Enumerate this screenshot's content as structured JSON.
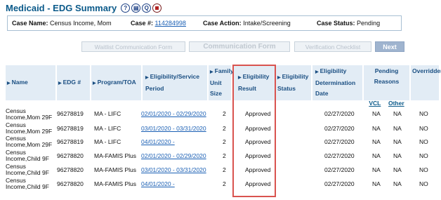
{
  "page": {
    "title": "Medicaid - EDG Summary"
  },
  "title_icons": [
    {
      "name": "help-icon",
      "glyph": "?"
    },
    {
      "name": "notes-icon",
      "glyph": "▤"
    },
    {
      "name": "query-icon",
      "glyph": "Q"
    },
    {
      "name": "stop-icon",
      "glyph": ""
    }
  ],
  "case_info": {
    "name_label": "Case Name:",
    "name_value": "Census Income, Mom",
    "number_label": "Case #:",
    "number_value": "114284998",
    "action_label": "Case Action:",
    "action_value": "Intake/Screening",
    "status_label": "Case Status:",
    "status_value": "Pending"
  },
  "buttons": {
    "waitlist": "Waitlist Communication Form",
    "communication": "Communication Form",
    "verification": "Verification Checklist",
    "next": "Next"
  },
  "table": {
    "headers": {
      "name": "Name",
      "edg": "EDG #",
      "program": "Program/TOA",
      "period": "Eligibility/Service Period",
      "family": "Family Unit Size",
      "result": "Eligibility Result",
      "status": "Eligibility Status",
      "determination": "Eligibility Determination Date",
      "pending": "Pending Reasons",
      "vcl": "VCL",
      "other": "Other",
      "overridden": "Overridden"
    },
    "rows": [
      {
        "name": "Census Income,Mom 29F",
        "edg": "96278819",
        "program": "MA - LIFC",
        "period": "02/01/2020 - 02/29/2020",
        "size": "2",
        "result": "Approved",
        "date": "02/27/2020",
        "vcl": "NA",
        "other": "NA",
        "overridden": "NO"
      },
      {
        "name": "Census Income,Mom 29F",
        "edg": "96278819",
        "program": "MA - LIFC",
        "period": "03/01/2020 - 03/31/2020",
        "size": "2",
        "result": "Approved",
        "date": "02/27/2020",
        "vcl": "NA",
        "other": "NA",
        "overridden": "NO"
      },
      {
        "name": "Census Income,Mom 29F",
        "edg": "96278819",
        "program": "MA - LIFC",
        "period": "04/01/2020 -",
        "size": "2",
        "result": "Approved",
        "date": "02/27/2020",
        "vcl": "NA",
        "other": "NA",
        "overridden": "NO"
      },
      {
        "name": "Census Income,Child 9F",
        "edg": "96278820",
        "program": "MA-FAMIS Plus",
        "period": "02/01/2020 - 02/29/2020",
        "size": "2",
        "result": "Approved",
        "date": "02/27/2020",
        "vcl": "NA",
        "other": "NA",
        "overridden": "NO"
      },
      {
        "name": "Census Income,Child 9F",
        "edg": "96278820",
        "program": "MA-FAMIS Plus",
        "period": "03/01/2020 - 03/31/2020",
        "size": "2",
        "result": "Approved",
        "date": "02/27/2020",
        "vcl": "NA",
        "other": "NA",
        "overridden": "NO"
      },
      {
        "name": "Census Income,Child 9F",
        "edg": "96278820",
        "program": "MA-FAMIS Plus",
        "period": "04/01/2020 -",
        "size": "2",
        "result": "Approved",
        "date": "02/27/2020",
        "vcl": "NA",
        "other": "NA",
        "overridden": "NO"
      }
    ]
  },
  "colors": {
    "title": "#0b5a8a",
    "header_bg": "#e2ecf5",
    "link": "#1a5fb4",
    "highlight": "#d9534f"
  }
}
